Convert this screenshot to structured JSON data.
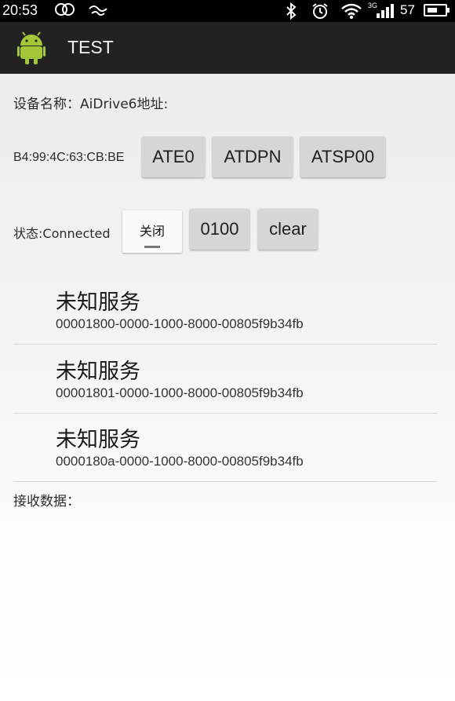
{
  "status_bar": {
    "time": "20:53",
    "battery_level": "57",
    "network_label": "3G",
    "icons": [
      "dual-circle-icon",
      "gesture-icon",
      "bluetooth-icon",
      "alarm-icon",
      "wifi-icon",
      "signal-icon",
      "battery-icon"
    ]
  },
  "action_bar": {
    "title": "TEST",
    "logo": "android-icon"
  },
  "device": {
    "name_line": "设备名称：AiDrive6地址:",
    "address": "B4:99:4C:63:CB:BE"
  },
  "buttons": {
    "ate0": "ATE0",
    "atdpn": "ATDPN",
    "atsp00": "ATSP00",
    "cmd_0100": "0100",
    "clear": "clear"
  },
  "status": {
    "text": "状态:Connected",
    "toggle_label": "关闭"
  },
  "services": [
    {
      "name": "未知服务",
      "uuid": "00001800-0000-1000-8000-00805f9b34fb"
    },
    {
      "name": "未知服务",
      "uuid": "00001801-0000-1000-8000-00805f9b34fb"
    },
    {
      "name": "未知服务",
      "uuid": "0000180a-0000-1000-8000-00805f9b34fb"
    }
  ],
  "receive": {
    "label": "接收数据："
  },
  "colors": {
    "action_bar_bg": "#222222",
    "button_bg": "#d6d6d6",
    "android_green": "#a4c639"
  }
}
